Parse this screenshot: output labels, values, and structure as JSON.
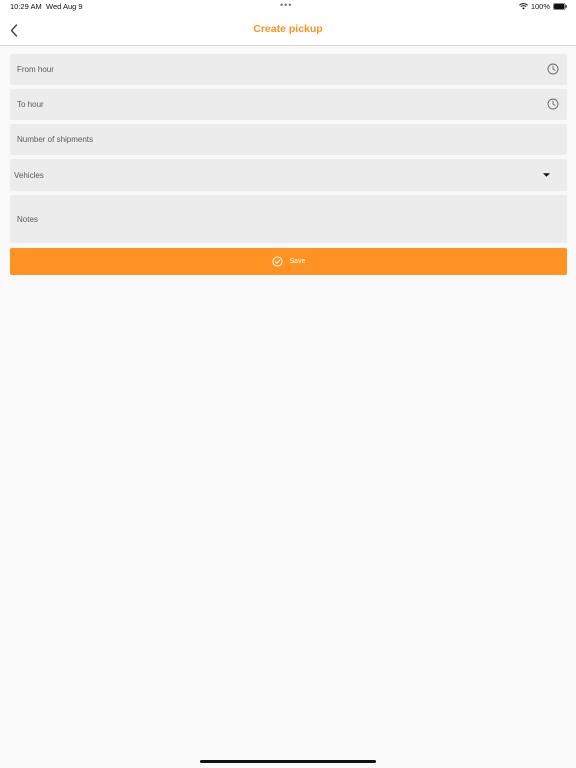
{
  "status_bar": {
    "time": "10:29 AM",
    "date": "Wed Aug 9",
    "dots": "•••",
    "battery": "100%"
  },
  "nav": {
    "back_icon": "chevron-left-icon",
    "title": "Create pickup"
  },
  "form": {
    "from_hour": {
      "placeholder": "From hour",
      "icon": "clock-icon"
    },
    "to_hour": {
      "placeholder": "To hour",
      "icon": "clock-icon"
    },
    "shipments": {
      "placeholder": "Number of shipments"
    },
    "vehicles": {
      "placeholder": "Vehicles",
      "icon": "caret-down-icon"
    },
    "notes": {
      "placeholder": "Notes"
    },
    "save_label": "Save",
    "save_icon": "check-circle-icon"
  },
  "colors": {
    "accent": "#f7931e",
    "button": "#ff9223",
    "field_bg": "#ececec",
    "page_bg": "#f9f9f9"
  }
}
